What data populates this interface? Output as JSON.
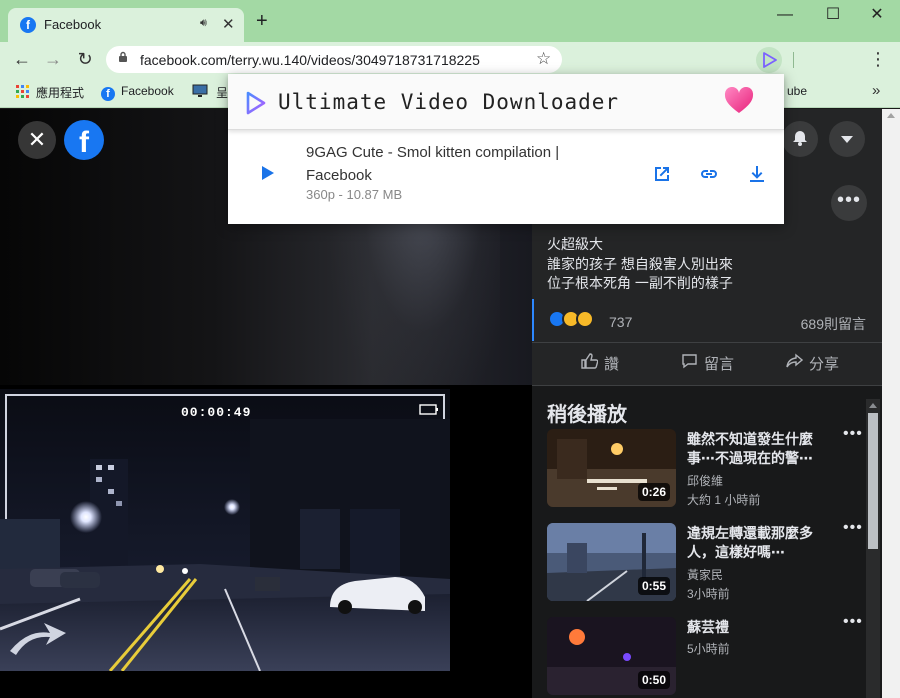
{
  "browser": {
    "tab_title": "Facebook",
    "tab_favicon": "facebook-icon",
    "new_tab_label": "+",
    "url": "facebook.com/terry.wu.140/videos/3049718731718225",
    "window_controls": {
      "minimize": "—",
      "maximize": "☐",
      "close": "✕"
    }
  },
  "bookmarks": {
    "items": [
      {
        "label": "應用程式",
        "icon": "apps-grid-icon"
      },
      {
        "label": "Facebook",
        "icon": "facebook-icon"
      },
      {
        "label": "",
        "icon": "monitor-icon"
      },
      {
        "label": "呈",
        "icon": "bookmark-icon"
      }
    ],
    "partial_right": "ube",
    "more": "»"
  },
  "extension_popup": {
    "title": "Ultimate Video Downloader",
    "video_title": "9GAG Cute - Smol kitten compilation | Facebook",
    "video_meta": "360p - 10.87 MB",
    "actions": [
      "open-external-icon",
      "copy-link-icon",
      "download-icon"
    ],
    "accent_color": "#1a73e8",
    "heart_color": "#ff4fa0"
  },
  "video": {
    "close_label": "✕",
    "logo_letter": "f",
    "timestamp": "00:00:49"
  },
  "post": {
    "lines": [
      "火超級大",
      "誰家的孩子 想自殺害人別出來",
      "位子根本死角  一副不削的樣子"
    ],
    "reaction_count": "737",
    "comment_count": "689則留言",
    "actions": [
      {
        "label": "讚",
        "icon": "thumbs-up-icon"
      },
      {
        "label": "留言",
        "icon": "comment-icon"
      },
      {
        "label": "分享",
        "icon": "share-icon"
      }
    ],
    "more_label": "•••"
  },
  "watch_later": {
    "title": "稍後播放",
    "videos": [
      {
        "title": "雖然不知道發生什麼事⋯不過現在的警⋯",
        "author": "邱俊維",
        "time": "大約 1 小時前",
        "duration": "0:26"
      },
      {
        "title": "違規左轉還載那麼多人，這樣好嗎⋯",
        "author": "黃家民",
        "time": "3小時前",
        "duration": "0:55"
      },
      {
        "title": "蘇芸禮",
        "author": "5小時前",
        "time": "",
        "duration": "0:50"
      }
    ]
  }
}
